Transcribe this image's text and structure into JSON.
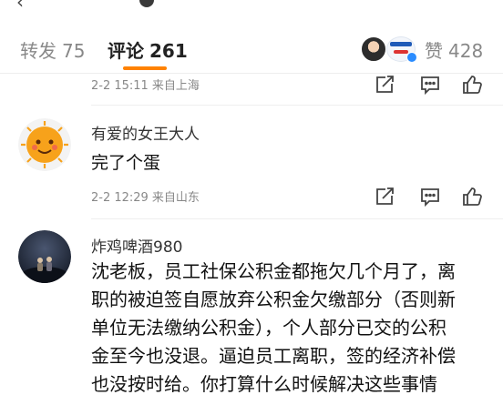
{
  "tabs": {
    "repost": {
      "label": "转发",
      "count": "75"
    },
    "comments": {
      "label": "评论",
      "count": "261"
    },
    "likes": {
      "label": "赞",
      "count": "428"
    }
  },
  "comments": [
    {
      "username": "",
      "text": "",
      "date": "2-2 15:11",
      "location": "来自上海"
    },
    {
      "username": "有爱的女王大人",
      "text": "完了个蛋",
      "date": "2-2 12:29",
      "location": "来自山东"
    },
    {
      "username": "炸鸡啤酒980",
      "lines": [
        "沈老板，员工社保公积金都拖欠几个月了，离",
        "职的被迫签自愿放弃公积金欠缴部分（否则新",
        "单位无法缴纳公积金），个人部分已交的公积",
        "金至今也没退。逼迫员工离职，签的经济补偿",
        "也没按时给。你打算什么时候解决这些事情"
      ]
    }
  ],
  "colors": {
    "accent": "#ff8200",
    "muted": "#888888",
    "text": "#111111"
  }
}
